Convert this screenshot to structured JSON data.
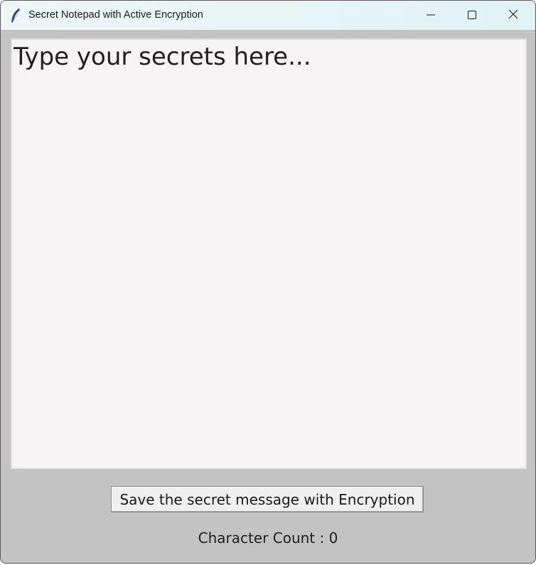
{
  "window": {
    "title": "Secret Notepad with Active Encryption",
    "app_icon": "feather-icon",
    "controls": {
      "minimize_icon": "minimize-icon",
      "maximize_icon": "maximize-icon",
      "close_icon": "close-icon"
    }
  },
  "editor": {
    "text": "Type your secrets here..."
  },
  "save_button": {
    "label": "Save the secret message with Encryption"
  },
  "status": {
    "char_count_label": "Character Count : ",
    "char_count_value": "0"
  }
}
